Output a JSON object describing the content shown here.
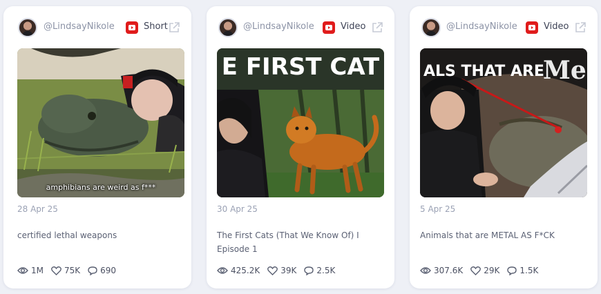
{
  "cards": [
    {
      "handle": "@LindsayNikole",
      "type": "Short",
      "date": "28 Apr 25",
      "description": "certified lethal weapons",
      "caption": "amphibians are weird as f***",
      "views": "1M",
      "likes": "75K",
      "comments": "690"
    },
    {
      "handle": "@LindsayNikole",
      "type": "Video",
      "date": "30 Apr 25",
      "description": "The First Cats (That We Know Of) I Episode 1",
      "thumb_text": "E FIRST CAT",
      "views": "425.2K",
      "likes": "39K",
      "comments": "2.5K"
    },
    {
      "handle": "@LindsayNikole",
      "type": "Video",
      "date": "5 Apr 25",
      "description": "Animals that are METAL AS F*CK",
      "thumb_text": "ALS THAT ARE",
      "thumb_text2": "Me",
      "views": "307.6K",
      "likes": "29K",
      "comments": "1.5K"
    }
  ],
  "icons": {
    "platform": "youtube-icon",
    "open": "external-link-icon",
    "views": "eye-icon",
    "likes": "heart-icon",
    "comments": "comment-icon"
  },
  "colors": {
    "background": "#eef0f6",
    "card": "#ffffff",
    "youtube": "#e01c1c",
    "muted_text": "#9aa1b4"
  }
}
